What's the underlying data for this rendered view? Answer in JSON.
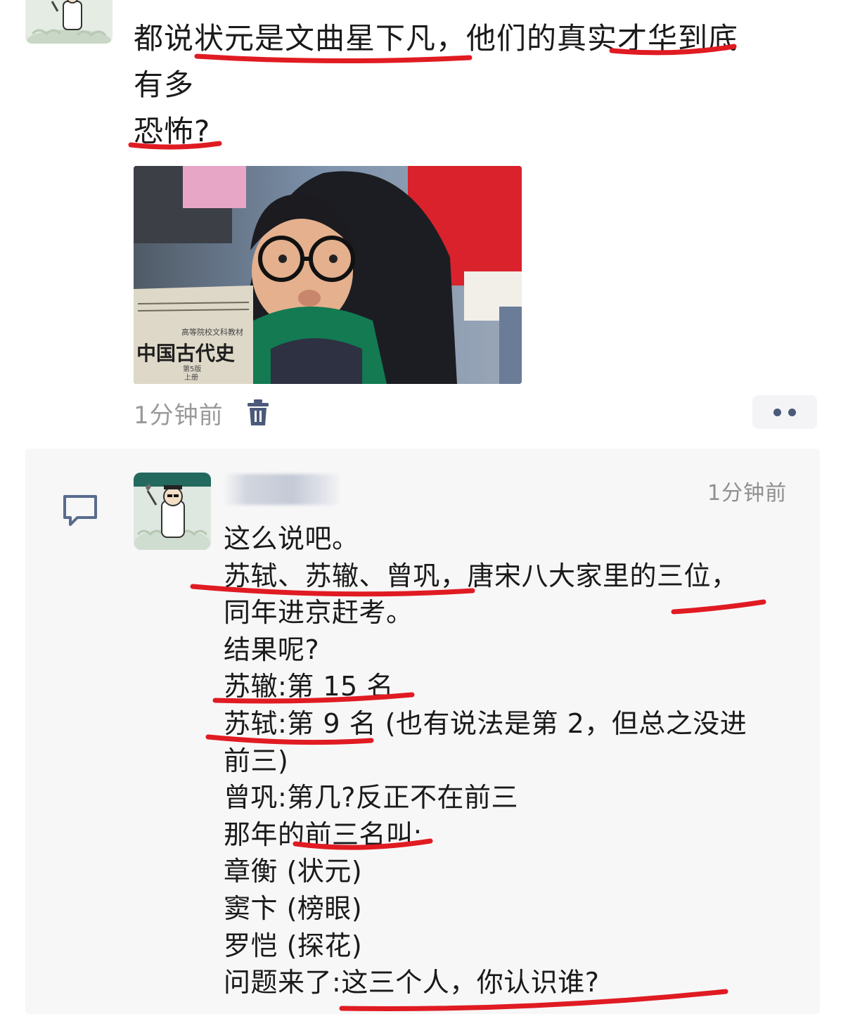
{
  "post": {
    "title_lines": [
      "都说状元是文曲星下凡，他们的真实才华到底",
      "有多",
      "恐怖?"
    ],
    "image_book_title": "中国古代史",
    "image_book_series": "高等院校文科教材",
    "image_book_edition": "第5版",
    "image_book_volume": "上册",
    "time": "1分钟前"
  },
  "comment": {
    "time": "1分钟前",
    "lines": [
      "这么说吧。",
      "苏轼、苏辙、曾巩，唐宋八大家里的三位，",
      "同年进京赶考。",
      "结果呢?",
      "苏辙:第 15 名",
      "苏轼:第 9 名 (也有说法是第 2，但总之没进",
      "前三)",
      "曾巩:第几?反正不在前三",
      "那年的前三名叫:",
      "章衡 (状元)",
      "窦卞 (榜眼)",
      "罗恺 (探花)",
      "问题来了:这三个人，你认识谁?"
    ]
  },
  "colors": {
    "underline": "#e01b22",
    "meta_gray": "#9a9a9a",
    "icon_blue": "#4b5a7a",
    "comment_bg": "#f7f7f8"
  },
  "icons": {
    "trash": "trash-icon",
    "more": "more-icon",
    "comment": "comment-icon"
  }
}
